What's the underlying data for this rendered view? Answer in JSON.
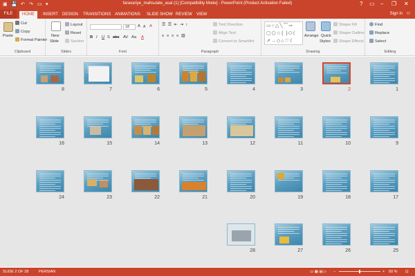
{
  "window": {
    "title": "faravariye_mahsulate_asal (1) [Compatibility Mode] - PowerPoint (Product Activation Failed)",
    "controls": [
      "?",
      "▭",
      "–",
      "❐",
      "✕"
    ]
  },
  "tabs": [
    "FILE",
    "HOME",
    "INSERT",
    "DESIGN",
    "TRANSITIONS",
    "ANIMATIONS",
    "SLIDE SHOW",
    "REVIEW",
    "VIEW"
  ],
  "active_tab": "HOME",
  "signin": "Sign in",
  "ribbon": {
    "clipboard": {
      "paste": "Paste",
      "cut": "Cut",
      "copy": "Copy",
      "format_painter": "Format Painter",
      "label": "Clipboard"
    },
    "slides": {
      "new_slide": "New",
      "new_slide2": "Slide",
      "layout": "Layout",
      "reset": "Reset",
      "section": "Section",
      "label": "Slides"
    },
    "font": {
      "font_name": "",
      "font_size": "18",
      "label": "Font",
      "buttons": [
        "B",
        "I",
        "U",
        "S",
        "abc",
        "AV",
        "Aa",
        "A",
        "A",
        "A",
        "A"
      ]
    },
    "paragraph": {
      "text_direction": "Text Direction",
      "align_text": "Align Text",
      "convert": "Convert to SmartArt",
      "label": "Paragraph"
    },
    "drawing": {
      "arrange": "Arrange",
      "quick_styles": "Quick",
      "quick_styles2": "Styles",
      "shape_fill": "Shape Fill",
      "shape_outline": "Shape Outline",
      "shape_effects": "Shape Effects",
      "label": "Drawing"
    },
    "editing": {
      "find": "Find",
      "replace": "Replace",
      "select": "Select",
      "label": "Editing"
    }
  },
  "slides": [
    {
      "n": "1"
    },
    {
      "n": "2"
    },
    {
      "n": "3"
    },
    {
      "n": "4"
    },
    {
      "n": "5"
    },
    {
      "n": "6"
    },
    {
      "n": "7"
    },
    {
      "n": "8"
    },
    {
      "n": "9"
    },
    {
      "n": "10"
    },
    {
      "n": "11"
    },
    {
      "n": "12"
    },
    {
      "n": "13"
    },
    {
      "n": "14"
    },
    {
      "n": "15"
    },
    {
      "n": "16"
    },
    {
      "n": "17"
    },
    {
      "n": "18"
    },
    {
      "n": "19"
    },
    {
      "n": "20"
    },
    {
      "n": "21"
    },
    {
      "n": "22"
    },
    {
      "n": "23"
    },
    {
      "n": "24"
    },
    {
      "n": "25"
    },
    {
      "n": "26"
    },
    {
      "n": "27"
    },
    {
      "n": "28"
    }
  ],
  "selected_slide": "2",
  "status": {
    "slide_info": "SLIDE 2 OF 28",
    "language": "PERSIAN",
    "zoom": "50 %",
    "zoom_fraction": 0.5
  },
  "colors": {
    "accent": "#c9442a",
    "selection": "#d24726",
    "slide_bg": "#5c9fc1"
  }
}
